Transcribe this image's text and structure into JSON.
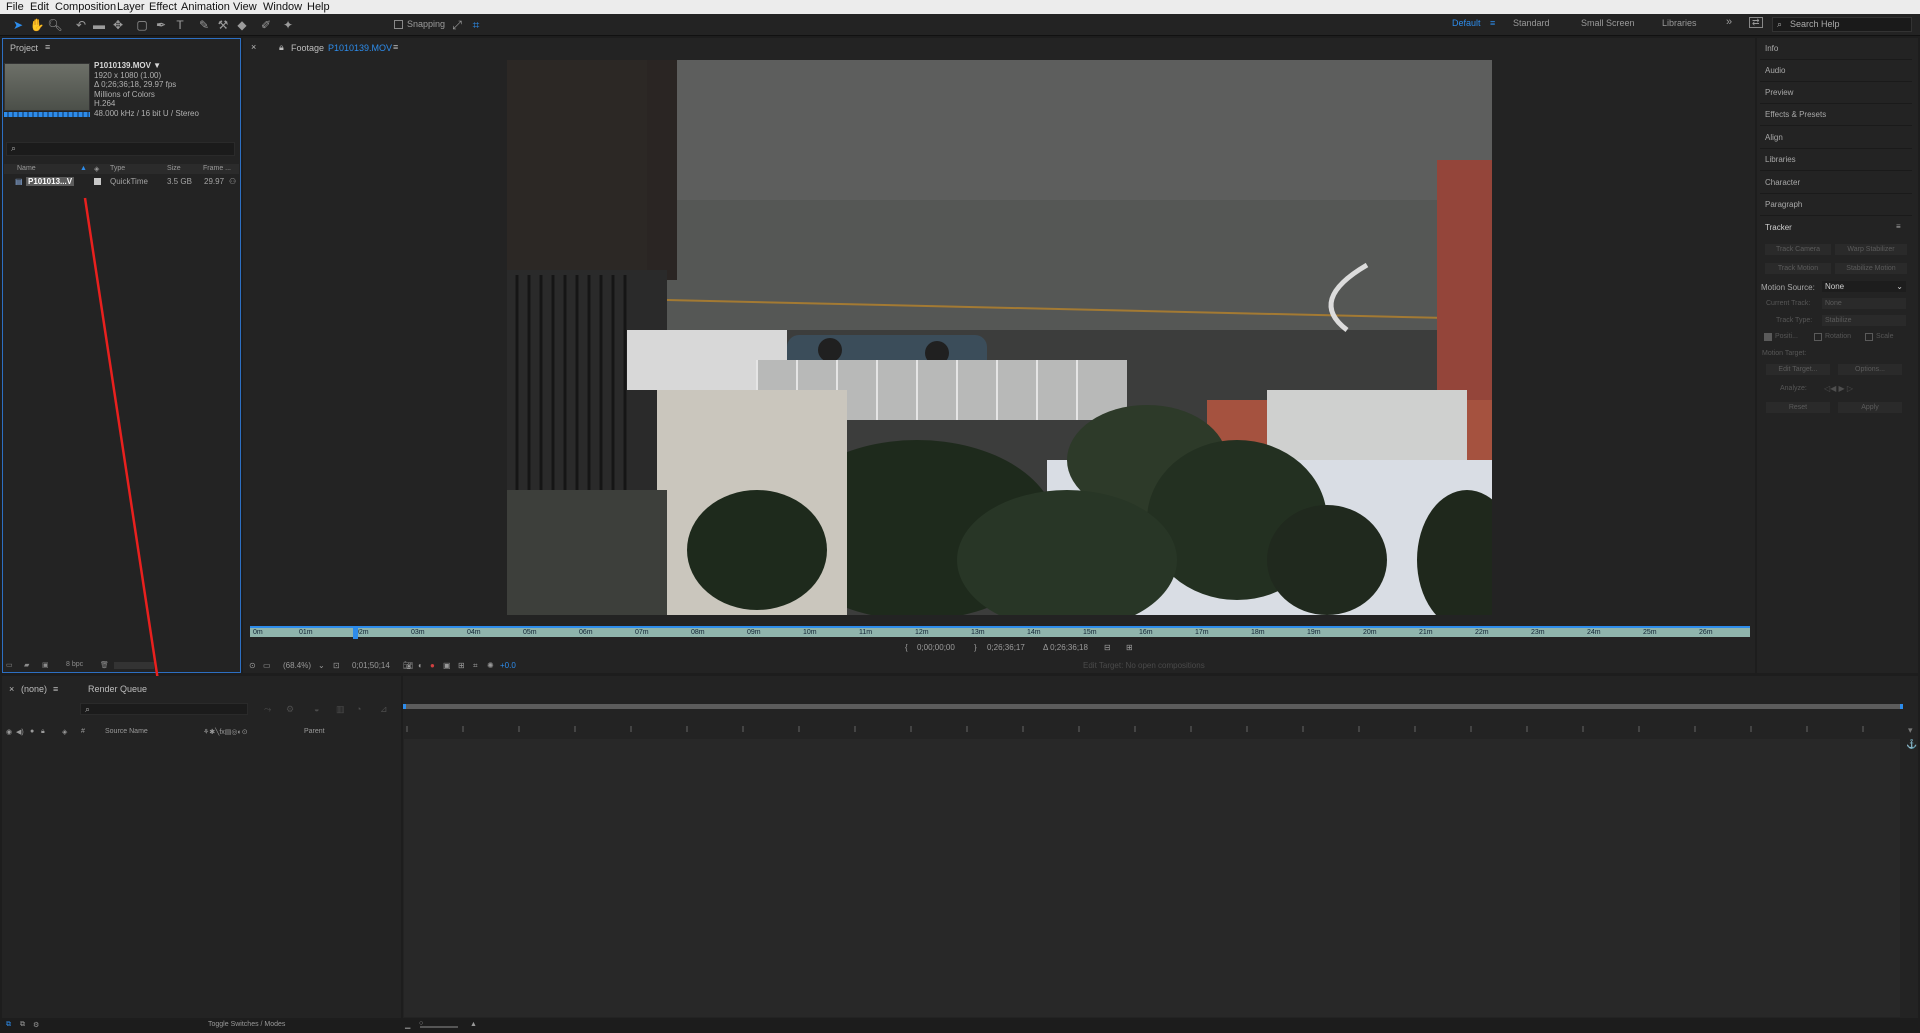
{
  "menu": [
    "File",
    "Edit",
    "Composition",
    "Layer",
    "Effect",
    "Animation",
    "View",
    "Window",
    "Help"
  ],
  "toolbar": {
    "snapping": "Snapping"
  },
  "workspaces": {
    "items": [
      "Default",
      "Standard",
      "Small Screen",
      "Libraries"
    ],
    "active": "Default"
  },
  "search_help": "Search Help",
  "project": {
    "title": "Project",
    "file": {
      "name": "P1010139.MOV ▼",
      "dimensions": "1920 x 1080 (1.00)",
      "duration": "Δ 0;26;36;18, 29.97 fps",
      "colors": "Millions of Colors",
      "codec": "H.264",
      "audio": "48.000 kHz / 16 bit U / Stereo"
    },
    "columns": {
      "name": "Name",
      "type": "Type",
      "size": "Size",
      "frame": "Frame ..."
    },
    "rows": [
      {
        "name": "P101013...V",
        "type": "QuickTime",
        "size": "3.5 GB",
        "frame": "29.97"
      }
    ],
    "bpc": "8 bpc"
  },
  "viewer": {
    "tab_label": "Footage",
    "tab_file": "P1010139.MOV",
    "ruler_ticks": [
      "0m",
      "01m",
      "02m",
      "03m",
      "04m",
      "05m",
      "06m",
      "07m",
      "08m",
      "09m",
      "10m",
      "11m",
      "12m",
      "13m",
      "14m",
      "15m",
      "16m",
      "17m",
      "18m",
      "19m",
      "20m",
      "21m",
      "22m",
      "23m",
      "24m",
      "25m",
      "26m"
    ],
    "in_point": "0;00;00;00",
    "out_point": "0;26;36;17",
    "duration": "Δ 0;26;36;18",
    "zoom": "(68.4%)",
    "current_time": "0;01;50;14",
    "exposure": "+0.0",
    "edit_target": "Edit Target: No open compositions"
  },
  "right_panels": [
    "Info",
    "Audio",
    "Preview",
    "Effects & Presets",
    "Align",
    "Libraries",
    "Character",
    "Paragraph",
    "Tracker"
  ],
  "tracker": {
    "track_camera": "Track Camera",
    "warp_stabilizer": "Warp Stabilizer",
    "track_motion": "Track Motion",
    "stabilize_motion": "Stabilize Motion",
    "motion_source_label": "Motion Source:",
    "motion_source_value": "None",
    "current_track_label": "Current Track:",
    "current_track_value": "None",
    "track_type_label": "Track Type:",
    "track_type_value": "Stabilize",
    "position": "Positi...",
    "rotation": "Rotation",
    "scale": "Scale",
    "motion_target": "Motion Target:",
    "edit_target": "Edit Target...",
    "options": "Options...",
    "analyze": "Analyze:",
    "reset": "Reset",
    "apply": "Apply"
  },
  "timeline": {
    "tab_none": "(none)",
    "tab_render": "Render Queue",
    "col_num": "#",
    "col_source": "Source Name",
    "col_parent": "Parent",
    "toggle": "Toggle Switches / Modes"
  }
}
